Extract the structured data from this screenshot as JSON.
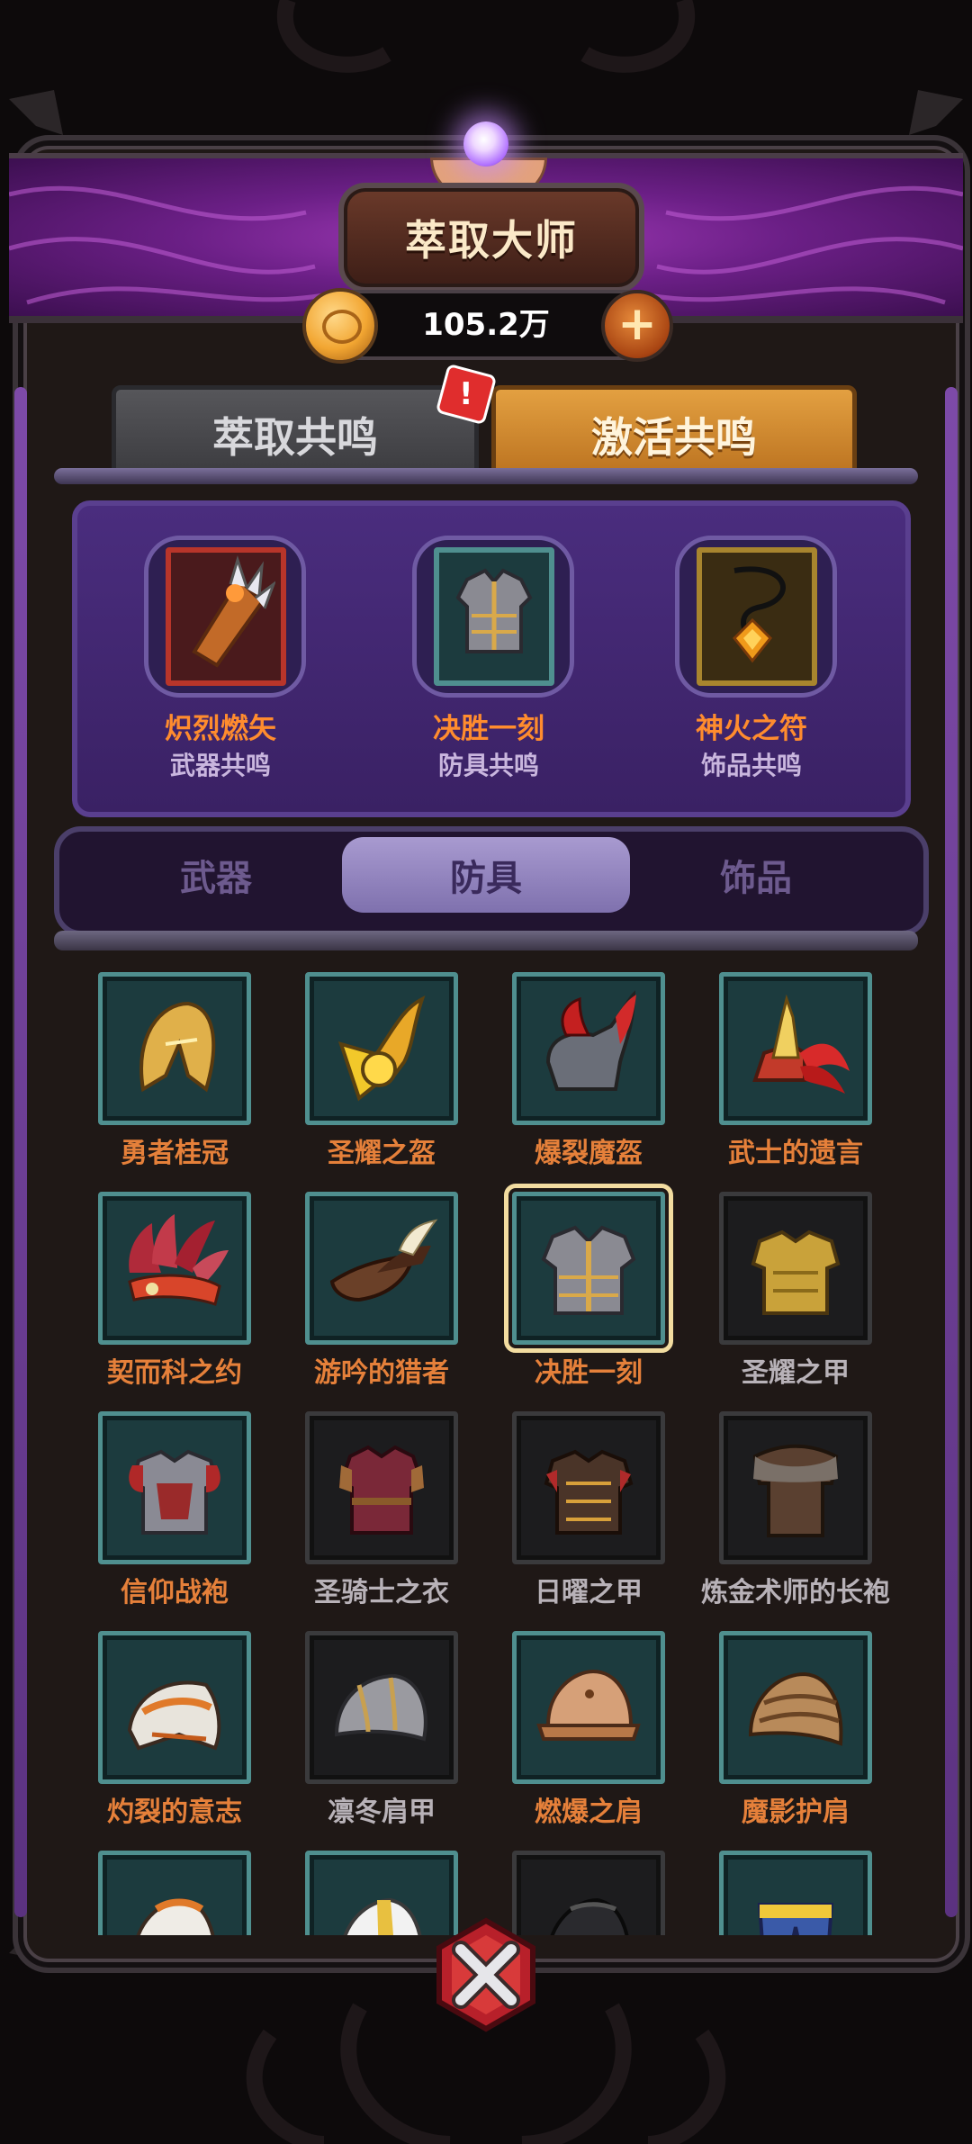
{
  "header": {
    "title": "萃取大师",
    "currency_value": "105.2万"
  },
  "mode_tabs": {
    "extract": "萃取共鸣",
    "activate": "激活共鸣",
    "alert": "!"
  },
  "resonance": [
    {
      "name": "炽烈燃矢",
      "type": "武器共鸣",
      "color": "#ff8c2e",
      "icon": "burning-bracer-icon"
    },
    {
      "name": "决胜一刻",
      "type": "防具共鸣",
      "color": "#ff8c2e",
      "icon": "breastplate-icon"
    },
    {
      "name": "神火之符",
      "type": "饰品共鸣",
      "color": "#ff8c2e",
      "icon": "amulet-icon"
    }
  ],
  "categories": {
    "weapons": "武器",
    "armor": "防具",
    "accessories": "饰品",
    "active": "armor"
  },
  "items": [
    {
      "name": "勇者桂冠",
      "owned": true,
      "icon": "golden-helmet-icon"
    },
    {
      "name": "圣耀之盔",
      "owned": true,
      "icon": "winged-helmet-icon"
    },
    {
      "name": "爆裂魔盔",
      "owned": true,
      "icon": "demon-helmet-icon"
    },
    {
      "name": "武士的遗言",
      "owned": true,
      "icon": "samurai-helmet-icon"
    },
    {
      "name": "契而科之约",
      "owned": true,
      "icon": "feather-headdress-icon"
    },
    {
      "name": "游吟的猎者",
      "owned": true,
      "icon": "hunter-hat-icon"
    },
    {
      "name": "决胜一刻",
      "owned": true,
      "selected": true,
      "icon": "breastplate-icon"
    },
    {
      "name": "圣耀之甲",
      "owned": false,
      "icon": "golden-armor-icon"
    },
    {
      "name": "信仰战袍",
      "owned": true,
      "icon": "red-armor-icon"
    },
    {
      "name": "圣骑士之衣",
      "owned": false,
      "icon": "paladin-tunic-icon"
    },
    {
      "name": "日曜之甲",
      "owned": false,
      "icon": "sun-armor-icon"
    },
    {
      "name": "炼金术师的长袍",
      "owned": false,
      "icon": "alchemist-robe-icon"
    },
    {
      "name": "灼裂的意志",
      "owned": true,
      "icon": "flame-pauldron-icon"
    },
    {
      "name": "凛冬肩甲",
      "owned": false,
      "icon": "winter-pauldron-icon"
    },
    {
      "name": "燃爆之肩",
      "owned": true,
      "icon": "copper-pauldron-icon"
    },
    {
      "name": "魔影护肩",
      "owned": true,
      "icon": "shadow-pauldron-icon"
    },
    {
      "name": "",
      "owned": true,
      "icon": "white-pauldron-icon"
    },
    {
      "name": "",
      "owned": true,
      "icon": "silver-pauldron-icon"
    },
    {
      "name": "",
      "owned": false,
      "icon": "black-pauldron-icon"
    },
    {
      "name": "",
      "owned": true,
      "icon": "pants-icon"
    }
  ]
}
